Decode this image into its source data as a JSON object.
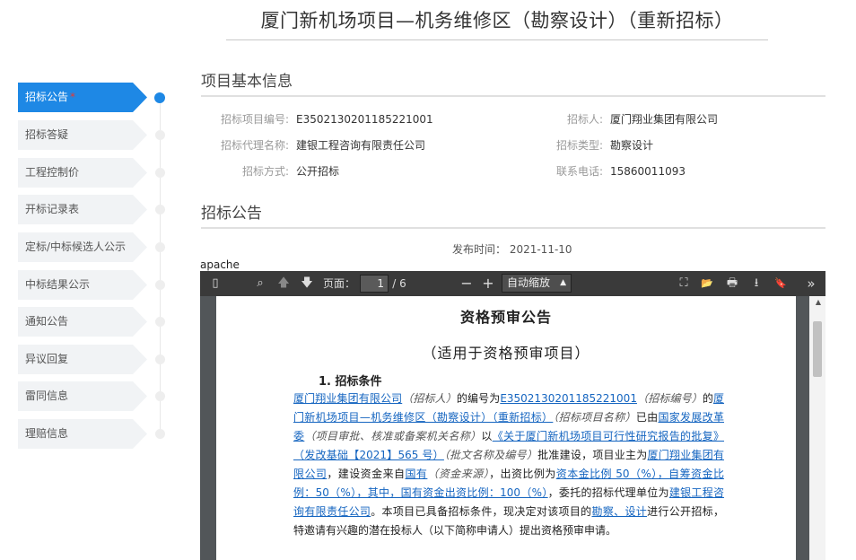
{
  "page_title": "厦门新机场项目—机务维修区（勘察设计）（重新招标）",
  "sidebar": {
    "items": [
      {
        "label": "招标公告",
        "marker": "*"
      },
      {
        "label": "招标答疑"
      },
      {
        "label": "工程控制价"
      },
      {
        "label": "开标记录表"
      },
      {
        "label": "定标/中标候选人公示"
      },
      {
        "label": "中标结果公示"
      },
      {
        "label": "通知公告"
      },
      {
        "label": "异议回复"
      },
      {
        "label": "雷同信息"
      },
      {
        "label": "理赔信息"
      }
    ]
  },
  "basic_info": {
    "title": "项目基本信息",
    "fields": [
      {
        "key": "招标项目编号:",
        "value": "E3502130201185221001"
      },
      {
        "key": "招标代理名称:",
        "value": "建银工程咨询有限责任公司"
      },
      {
        "key": "招标方式:",
        "value": "公开招标"
      },
      {
        "key": "招标人:",
        "value": "厦门翔业集团有限公司"
      },
      {
        "key": "招标类型:",
        "value": "勘察设计"
      },
      {
        "key": "联系电话:",
        "value": "15860011093"
      }
    ]
  },
  "announcement": {
    "title": "招标公告",
    "publish_time": "发布时间： 2021-11-10"
  },
  "pdf_viewer": {
    "frame_title": "apache",
    "page_label": "页面：",
    "page_current": "1",
    "page_total": "/ 6",
    "zoom_value": "自动缩放",
    "icons": {
      "sidebar_toggle": "▯",
      "search": "⌕",
      "prev": "🡅",
      "next": "🡇",
      "zoom_out": "−",
      "zoom_in": "+",
      "present": "⛶",
      "open": "📂",
      "print": "🖶",
      "download": "⭳",
      "bookmark": "🔖",
      "more": "»"
    },
    "doc": {
      "heading": "资格预审公告",
      "subheading": "（适用于资格预审项目）",
      "section": "1.  招标条件",
      "body": [
        {
          "t": "厦门翔业集团有限公司",
          "s": "u"
        },
        {
          "t": "（招标人）",
          "s": "i"
        },
        {
          "t": "的编号为",
          "s": ""
        },
        {
          "t": "E3502130201185221001",
          "s": "u"
        },
        {
          "t": "（招标编号）",
          "s": "i"
        },
        {
          "t": "的",
          "s": ""
        },
        {
          "t": "厦门新机场项目—机务维修区（勘察设计）（重新招标）",
          "s": "u"
        },
        {
          "t": "（招标项目名称）",
          "s": "i"
        },
        {
          "t": "已由",
          "s": ""
        },
        {
          "t": "国家发展改革委",
          "s": "u"
        },
        {
          "t": "（项目审批、核准或备案机关名称）",
          "s": "i"
        },
        {
          "t": "以",
          "s": ""
        },
        {
          "t": "《关于厦门新机场项目可行性研究报告的批复》（发改基础【2021】565 号）",
          "s": "u"
        },
        {
          "t": "（批文名称及编号）",
          "s": "i"
        },
        {
          "t": "批准建设，项目业主为",
          "s": ""
        },
        {
          "t": "厦门翔业集团有限公司",
          "s": "u"
        },
        {
          "t": "，建设资金来自",
          "s": ""
        },
        {
          "t": "国有",
          "s": "u"
        },
        {
          "t": "（资金来源）",
          "s": "i"
        },
        {
          "t": "，出资比例为",
          "s": ""
        },
        {
          "t": "资本金比例 50（%），自筹资金比例：50（%），其中，国有资金出资比例：100（%）",
          "s": "u"
        },
        {
          "t": "，委托的招标代理单位为",
          "s": ""
        },
        {
          "t": "建银工程咨询有限责任公司",
          "s": "u"
        },
        {
          "t": "。本项目已具备招标条件，现决定对该项目的",
          "s": ""
        },
        {
          "t": "勘察、设计",
          "s": "u"
        },
        {
          "t": "进行公开招标，特邀请有兴趣的潜在投标人（以下简称申请人）提出资格预审申请。",
          "s": ""
        }
      ]
    }
  },
  "colors": {
    "accent": "#1e88e5",
    "marker": "#e53935",
    "link": "#1565c0",
    "toolbar": "#3a3a3a"
  }
}
